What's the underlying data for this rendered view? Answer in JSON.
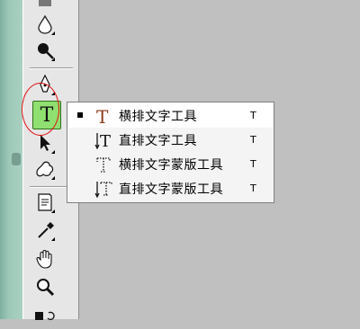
{
  "toolbox": {
    "tools": [
      {
        "name": "blur",
        "icon": "water-drop-icon"
      },
      {
        "name": "burn",
        "icon": "burn-icon"
      },
      {
        "name": "pen",
        "icon": "pen-icon"
      },
      {
        "name": "type",
        "icon": "type-icon",
        "active": true,
        "glyph": "T"
      },
      {
        "name": "path-selection",
        "icon": "arrow-icon"
      },
      {
        "name": "custom-shape",
        "icon": "shape-icon"
      },
      {
        "name": "notes",
        "icon": "note-icon"
      },
      {
        "name": "eyedropper",
        "icon": "eyedropper-icon"
      },
      {
        "name": "hand",
        "icon": "hand-icon"
      },
      {
        "name": "zoom",
        "icon": "zoom-icon"
      }
    ],
    "active_color": "#8fe070",
    "highlight_circle_color": "#e01010"
  },
  "flyout": {
    "items": [
      {
        "label": "横排文字工具",
        "shortcut": "T",
        "selected": true,
        "icon": "horizontal-type-icon"
      },
      {
        "label": "直排文字工具",
        "shortcut": "T",
        "selected": false,
        "icon": "vertical-type-icon"
      },
      {
        "label": "横排文字蒙版工具",
        "shortcut": "T",
        "selected": false,
        "icon": "horizontal-type-mask-icon"
      },
      {
        "label": "直排文字蒙版工具",
        "shortcut": "T",
        "selected": false,
        "icon": "vertical-type-mask-icon"
      }
    ]
  }
}
